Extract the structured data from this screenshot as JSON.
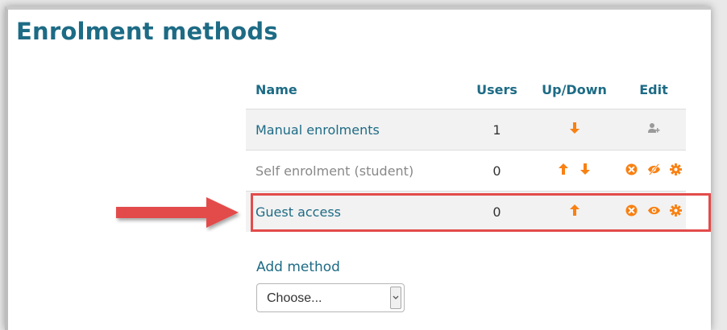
{
  "page": {
    "title": "Enrolment methods"
  },
  "table": {
    "headers": {
      "name": "Name",
      "users": "Users",
      "updown": "Up/Down",
      "edit": "Edit"
    },
    "rows": [
      {
        "name": "Manual enrolments",
        "users": "1",
        "updown": [
          "arrow-down-icon"
        ],
        "edit": [
          "enrol-users-icon"
        ],
        "enabled": true
      },
      {
        "name": "Self enrolment (student)",
        "users": "0",
        "updown": [
          "arrow-up-icon",
          "arrow-down-icon"
        ],
        "edit": [
          "delete-icon",
          "hidden-eye-icon",
          "settings-gear-icon"
        ],
        "enabled": false
      },
      {
        "name": "Guest access",
        "users": "0",
        "updown": [
          "arrow-up-icon"
        ],
        "edit": [
          "delete-icon",
          "eye-icon",
          "settings-gear-icon"
        ],
        "enabled": true,
        "highlighted": true
      }
    ]
  },
  "add_method": {
    "label": "Add method",
    "selected": "Choose..."
  },
  "colors": {
    "accent": "#1d6b85",
    "icon": "#f98012",
    "highlight": "#e34b4b"
  }
}
